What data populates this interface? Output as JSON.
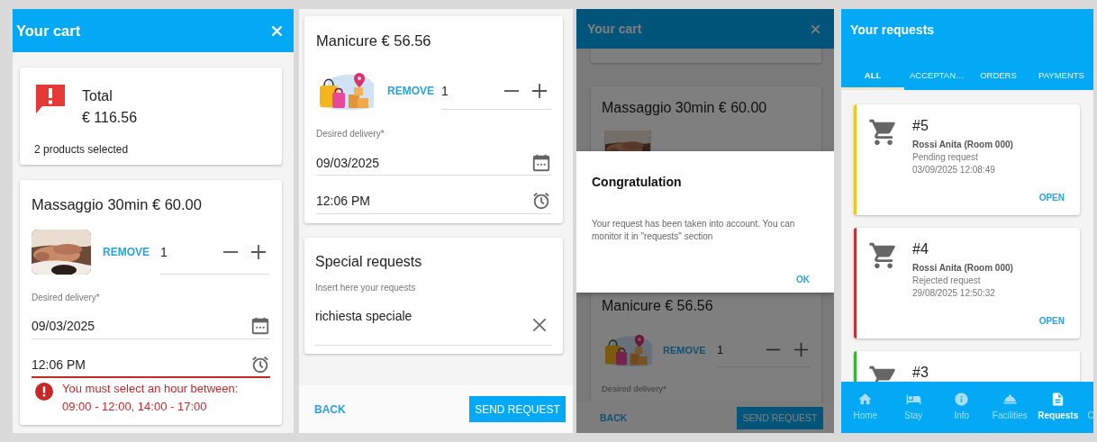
{
  "screens": [
    {
      "kind": "cart",
      "header": {
        "title": "Your cart"
      },
      "summary": {
        "title": "Total",
        "amount": "€ 116.56",
        "note": "2 products selected"
      },
      "products": [
        {
          "name": "Massaggio 30min € 60.00",
          "remove": "REMOVE",
          "quantity": "1",
          "delivery_label": "Desired delivery*",
          "date": "09/03/2025",
          "time": "12:06 PM",
          "time_error": true,
          "error_lines": [
            "You must select an hour between:",
            "09:00 - 12:00, 14:00 - 17:00"
          ]
        }
      ]
    },
    {
      "kind": "cart_end",
      "products": [
        {
          "name": "Manicure € 56.56",
          "remove": "REMOVE",
          "quantity": "1",
          "delivery_label": "Desired delivery*",
          "date": "09/03/2025",
          "time": "12:06 PM",
          "time_error": false
        }
      ],
      "special_requests": {
        "title": "Special requests",
        "label": "Insert here your requests",
        "value": "richiesta speciale"
      },
      "footer": {
        "back": "BACK",
        "send": "SEND REQUEST"
      }
    },
    {
      "kind": "confirmation",
      "header": {
        "title": "Your cart"
      },
      "background": {
        "first_product": {
          "name": "Massaggio 30min € 60.00"
        },
        "second_product": {
          "name": "Manicure € 56.56",
          "remove": "REMOVE",
          "quantity": "1",
          "delivery_label": "Desired delivery*"
        }
      },
      "footer": {
        "back": "BACK",
        "send": "SEND REQUEST"
      },
      "dialog": {
        "title": "Congratulation",
        "message": "Your request has been taken into account. You can monitor it in \"requests\" section",
        "action": "OK"
      }
    },
    {
      "kind": "requests",
      "header": {
        "title": "Your requests"
      },
      "tabs": [
        {
          "label": "ALL",
          "selected": true
        },
        {
          "label": "ACCEPTAN…",
          "selected": false
        },
        {
          "label": "ORDERS",
          "selected": false
        },
        {
          "label": "PAYMENTS",
          "selected": false
        }
      ],
      "requests": [
        {
          "number": "#5",
          "guest": "Rossi Anita (Room 000)",
          "status": "Pending request",
          "date": "03/09/2025 12:08:49",
          "action": "OPEN",
          "color": "#f5c518"
        },
        {
          "number": "#4",
          "guest": "Rossi Anita (Room 000)",
          "status": "Rejected request",
          "date": "29/08/2025 12:50:32",
          "action": "OPEN",
          "color": "#d32f2f"
        },
        {
          "number": "#3",
          "color": "#2eb82e"
        }
      ],
      "nav": [
        {
          "label": "Home",
          "selected": false
        },
        {
          "label": "Stay",
          "selected": false
        },
        {
          "label": "Info",
          "selected": false
        },
        {
          "label": "Facilities",
          "selected": false
        },
        {
          "label": "Requests",
          "selected": true
        },
        {
          "label": "C",
          "selected": false
        }
      ]
    }
  ]
}
